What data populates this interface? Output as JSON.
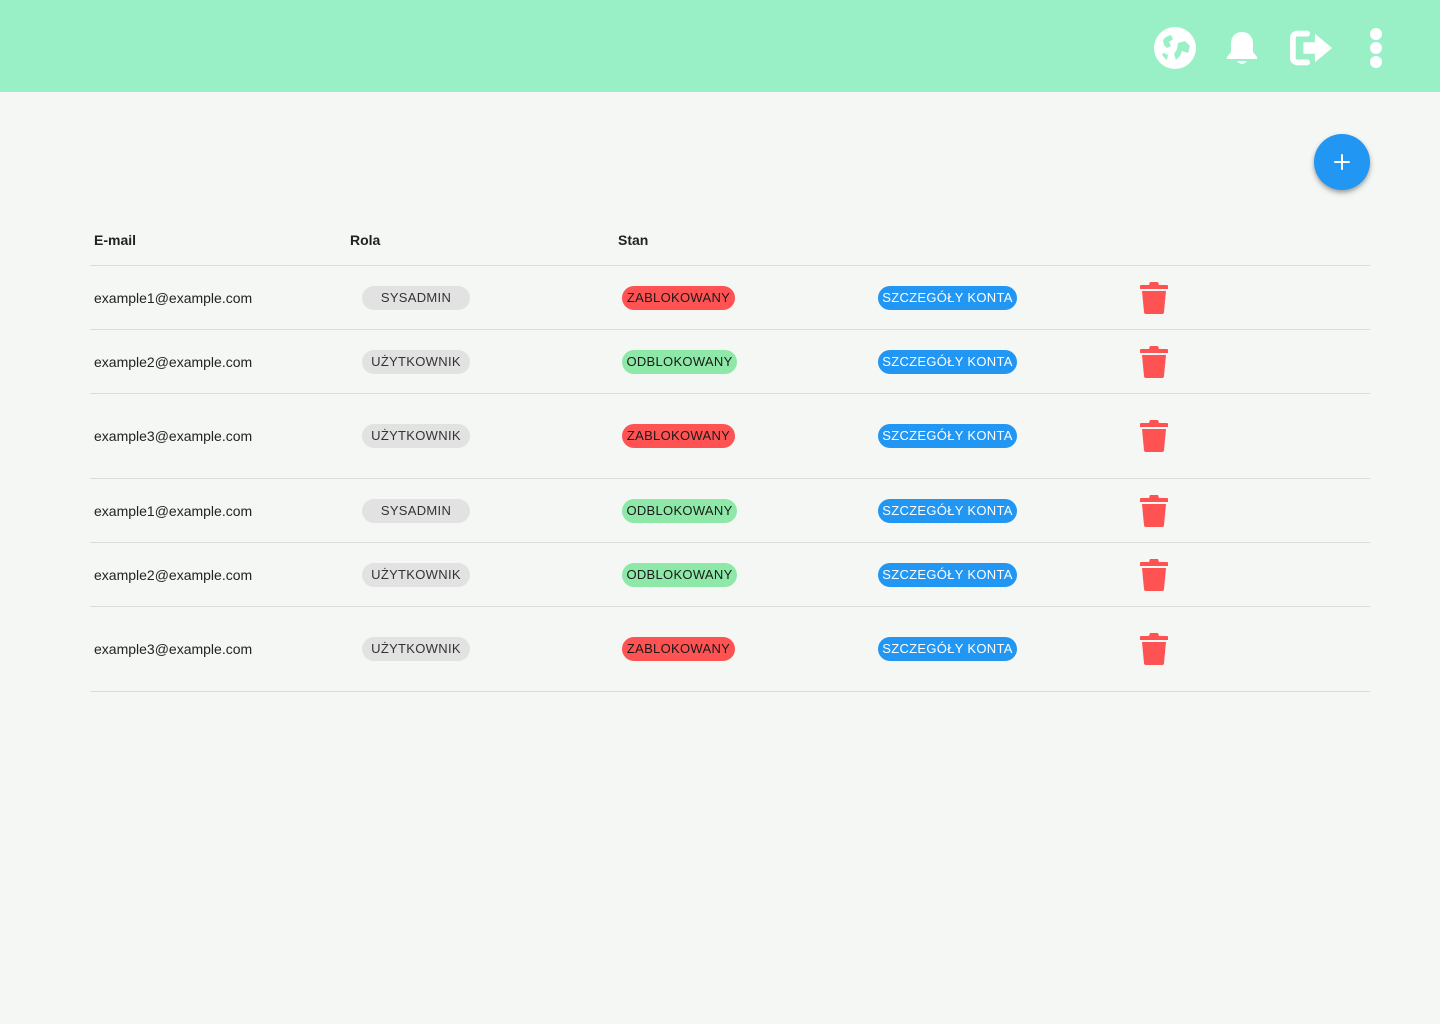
{
  "header": {
    "icons": [
      "globe-icon",
      "bell-icon",
      "logout-icon",
      "more-vert-icon"
    ],
    "background": "#9af0c6"
  },
  "fab": {
    "icon": "plus-icon",
    "color": "#2196f3"
  },
  "table": {
    "columns": [
      "E-mail",
      "Rola",
      "Stan"
    ],
    "rows": [
      {
        "email": "example1@example.com",
        "role": "SYSADMIN",
        "status": "ZABLOKOWANY",
        "status_type": "blocked",
        "details": "SZCZEGÓŁY KONTA"
      },
      {
        "email": "example2@example.com",
        "role": "UŻYTKOWNIK",
        "status": "ODBLOKOWANY",
        "status_type": "unblocked",
        "details": "SZCZEGÓŁY KONTA"
      },
      {
        "email": "example3@example.com",
        "role": "UŻYTKOWNIK",
        "status": "ZABLOKOWANY",
        "status_type": "blocked",
        "details": "SZCZEGÓŁY KONTA"
      },
      {
        "email": "example1@example.com",
        "role": "SYSADMIN",
        "status": "ODBLOKOWANY",
        "status_type": "unblocked",
        "details": "SZCZEGÓŁY KONTA"
      },
      {
        "email": "example2@example.com",
        "role": "UŻYTKOWNIK",
        "status": "ODBLOKOWANY",
        "status_type": "unblocked",
        "details": "SZCZEGÓŁY KONTA"
      },
      {
        "email": "example3@example.com",
        "role": "UŻYTKOWNIK",
        "status": "ZABLOKOWANY",
        "status_type": "blocked",
        "details": "SZCZEGÓŁY KONTA"
      }
    ]
  },
  "colors": {
    "blocked": "#ff5252",
    "unblocked": "#8ee9a8",
    "details": "#2196f3",
    "trash": "#ff5252"
  }
}
